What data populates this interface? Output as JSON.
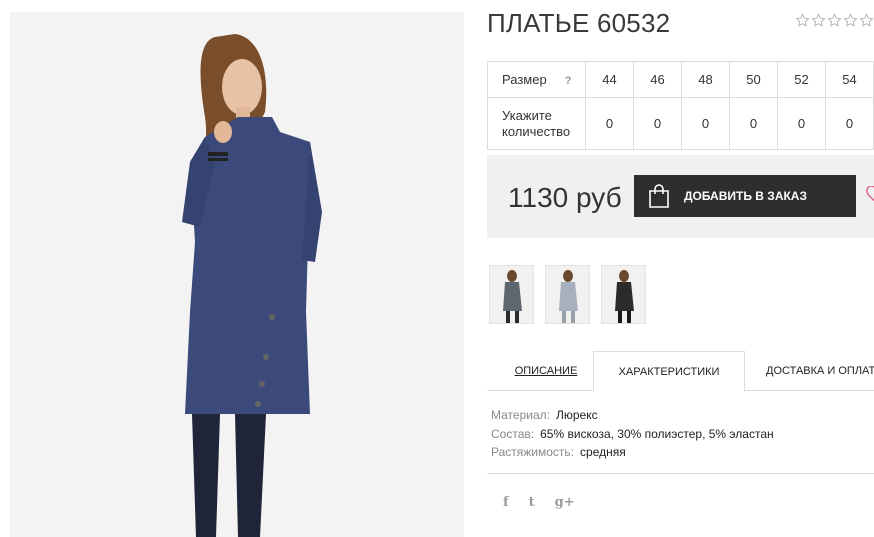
{
  "product": {
    "title": "ПЛАТЬЕ 60532",
    "rating": {
      "value": 0,
      "max": 5
    }
  },
  "size_table": {
    "size_label": "Размер",
    "help": "?",
    "qty_label": "Укажите количество",
    "sizes": [
      "44",
      "46",
      "48",
      "50",
      "52",
      "54"
    ],
    "quantities": [
      "0",
      "0",
      "0",
      "0",
      "0",
      "0"
    ]
  },
  "purchase": {
    "price": "1130 руб",
    "add_button": "ДОБАВИТЬ В ЗАКАЗ"
  },
  "tabs": [
    "ОПИСАНИЕ",
    "ХАРАКТЕРИСТИКИ",
    "ДОСТАВКА И ОПЛАТА"
  ],
  "characteristics": [
    {
      "key": "Материал:",
      "value": "Люрекс"
    },
    {
      "key": "Состав:",
      "value": "65% вискоза, 30% полиэстер, 5% эластан"
    },
    {
      "key": "Растяжимость:",
      "value": "средняя"
    }
  ],
  "social": [
    "f",
    "t",
    "g+"
  ],
  "colors": {
    "dress": "#3b4a7a",
    "button": "#2e2e2e",
    "heart": "#e26a8e",
    "price_bg": "#f0f0f0"
  },
  "icons": [
    "star-icon",
    "shopping-bag-icon",
    "heart-icon",
    "facebook-icon",
    "twitter-icon",
    "google-plus-icon"
  ]
}
